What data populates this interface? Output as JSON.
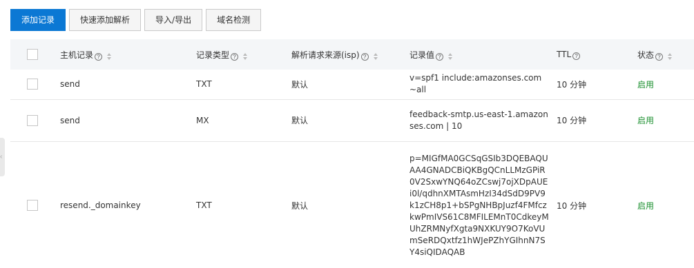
{
  "toolbar": {
    "add_record": "添加记录",
    "quick_add": "快速添加解析",
    "import_export": "导入/导出",
    "domain_check": "域名检测"
  },
  "table": {
    "headers": {
      "host": "主机记录",
      "type": "记录类型",
      "isp": "解析请求来源(isp)",
      "value": "记录值",
      "ttl": "TTL",
      "status": "状态"
    },
    "rows": [
      {
        "host": "send",
        "type": "TXT",
        "isp": "默认",
        "value": "v=spf1 include:amazonses.com ~all",
        "ttl": "10 分钟",
        "status": "启用"
      },
      {
        "host": "send",
        "type": "MX",
        "isp": "默认",
        "value": "feedback-smtp.us-east-1.amazonses.com | 10",
        "ttl": "10 分钟",
        "status": "启用"
      },
      {
        "host": "resend._domainkey",
        "type": "TXT",
        "isp": "默认",
        "value": "p=MIGfMA0GCSqGSIb3DQEBAQUAA4GNADCBiQKBgQCnLLMzGPiR0V2SxwYNQ64oZCswj7ojXDpAUEi0l/qdhnXMTAsmHzI34dSdD9PV9k1zCH8p1+bSPgNHBpJuzf4FMfczkwPmIVS61C8MFILEMnT0CdkeyMUhZRMNyfXgta9NXKUY9O7KoVUmSeRDQxtfz1hWJePZhYGIhnN7SY4siQIDAQAB",
        "ttl": "10 分钟",
        "status": "启用"
      }
    ]
  },
  "icons": {
    "help": "question-circle-icon",
    "sort": "sort-arrows-icon",
    "side": "collapse-arrow-icon"
  },
  "colors": {
    "primary": "#0b78d4",
    "status_enabled": "#1a8f2e",
    "header_bg": "#f4f6f8"
  }
}
